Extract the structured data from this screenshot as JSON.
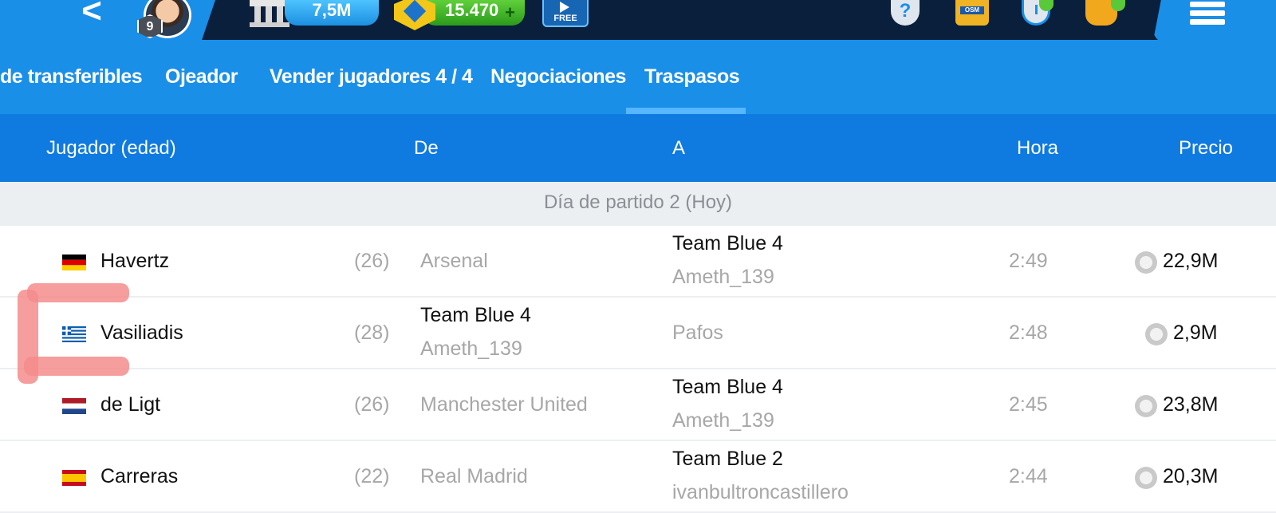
{
  "topbar": {
    "level": "9",
    "money": "7,5M",
    "credits": "15.470",
    "credits_plus": "+",
    "free_label": "FREE",
    "osm_label": "OSM",
    "help_symbol": "?",
    "back_symbol": "<"
  },
  "tabs": [
    {
      "label": "de transferibles"
    },
    {
      "label": "Ojeador"
    },
    {
      "label": "Vender jugadores 4 / 4"
    },
    {
      "label": "Negociaciones"
    },
    {
      "label": "Traspasos"
    }
  ],
  "active_tab": "Traspasos",
  "columns": {
    "player": "Jugador (edad)",
    "from": "De",
    "to": "A",
    "time": "Hora",
    "price": "Precio"
  },
  "day_banner": "Día de partido 2 (Hoy)",
  "rows": [
    {
      "flag": "germany",
      "name": "Havertz",
      "age": "(26)",
      "from": "Arsenal",
      "from_sub": "",
      "to": "Team Blue 4",
      "to_sub": "Ameth_139",
      "time": "2:49",
      "price": "22,9M"
    },
    {
      "flag": "greece",
      "name": "Vasiliadis",
      "age": "(28)",
      "from": "Team Blue 4",
      "from_sub": "Ameth_139",
      "to": "Pafos",
      "to_sub": "",
      "time": "2:48",
      "price": "2,9M"
    },
    {
      "flag": "netherlands",
      "name": "de Ligt",
      "age": "(26)",
      "from": "Manchester United",
      "from_sub": "",
      "to": "Team Blue 4",
      "to_sub": "Ameth_139",
      "time": "2:45",
      "price": "23,8M"
    },
    {
      "flag": "spain",
      "name": "Carreras",
      "age": "(22)",
      "from": "Real Madrid",
      "from_sub": "",
      "to": "Team Blue 2",
      "to_sub": "ivanbultroncastillero",
      "time": "2:44",
      "price": "20,3M"
    }
  ],
  "colors": {
    "topbar": "#0a1f3c",
    "accent": "#1a8fe8",
    "header": "#0f7ae0",
    "banner": "#eceff2",
    "annotation": "#f48c8c"
  }
}
